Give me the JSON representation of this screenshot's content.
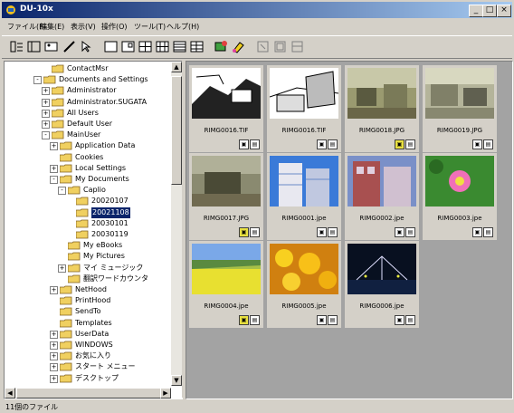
{
  "window": {
    "title": "DU-10x",
    "minimize": "_",
    "maximize": "□",
    "close": "×"
  },
  "menu": [
    "ファイル(F)",
    "編集(E)",
    "表示(V)",
    "操作(O)",
    "ツール(T)",
    "ヘルプ(H)"
  ],
  "tree": [
    {
      "label": "ContactMsr",
      "exp": "",
      "depth": 4
    },
    {
      "label": "Documents and Settings",
      "exp": "-",
      "depth": 3
    },
    {
      "label": "Administrator",
      "exp": "+",
      "depth": 4
    },
    {
      "label": "Administrator.SUGATA",
      "exp": "+",
      "depth": 4
    },
    {
      "label": "All Users",
      "exp": "+",
      "depth": 4
    },
    {
      "label": "Default User",
      "exp": "+",
      "depth": 4
    },
    {
      "label": "MainUser",
      "exp": "-",
      "depth": 4
    },
    {
      "label": "Application Data",
      "exp": "+",
      "depth": 5
    },
    {
      "label": "Cookies",
      "exp": "",
      "depth": 5
    },
    {
      "label": "Local Settings",
      "exp": "+",
      "depth": 5
    },
    {
      "label": "My Documents",
      "exp": "-",
      "depth": 5
    },
    {
      "label": "Caplio",
      "exp": "-",
      "depth": 6
    },
    {
      "label": "20020107",
      "exp": "",
      "depth": 7
    },
    {
      "label": "20021108",
      "exp": "",
      "depth": 7,
      "selected": true
    },
    {
      "label": "20030101",
      "exp": "",
      "depth": 7
    },
    {
      "label": "20030119",
      "exp": "",
      "depth": 7
    },
    {
      "label": "My eBooks",
      "exp": "",
      "depth": 6
    },
    {
      "label": "My Pictures",
      "exp": "",
      "depth": 6
    },
    {
      "label": "マイ ミュージック",
      "exp": "+",
      "depth": 6
    },
    {
      "label": "翻訳ワードカウンタ",
      "exp": "",
      "depth": 6
    },
    {
      "label": "NetHood",
      "exp": "+",
      "depth": 5
    },
    {
      "label": "PrintHood",
      "exp": "",
      "depth": 5
    },
    {
      "label": "SendTo",
      "exp": "",
      "depth": 5
    },
    {
      "label": "Templates",
      "exp": "",
      "depth": 5
    },
    {
      "label": "UserData",
      "exp": "+",
      "depth": 5
    },
    {
      "label": "WINDOWS",
      "exp": "+",
      "depth": 5
    },
    {
      "label": "お気に入り",
      "exp": "+",
      "depth": 5
    },
    {
      "label": "スタート メニュー",
      "exp": "+",
      "depth": 5
    },
    {
      "label": "デスクトップ",
      "exp": "+",
      "depth": 5
    }
  ],
  "thumbnails": [
    {
      "name": "RIMG0016.TIF",
      "scene": "sketch",
      "mark": ""
    },
    {
      "name": "RIMG0016.TIF",
      "scene": "sketch2",
      "mark": ""
    },
    {
      "name": "RIMG0018.JPG",
      "scene": "office",
      "mark": "y"
    },
    {
      "name": "RIMG0019.JPG",
      "scene": "office2",
      "mark": ""
    },
    {
      "name": "RIMG0017.JPG",
      "scene": "office3",
      "mark": "y"
    },
    {
      "name": "RIMG0001.jpe",
      "scene": "building",
      "mark": ""
    },
    {
      "name": "RIMG0002.jpe",
      "scene": "building2",
      "mark": ""
    },
    {
      "name": "RIMG0003.jpe",
      "scene": "flower",
      "mark": ""
    },
    {
      "name": "RIMG0004.jpe",
      "scene": "field",
      "mark": "y"
    },
    {
      "name": "RIMG0005.jpe",
      "scene": "yellow",
      "mark": ""
    },
    {
      "name": "RIMG0006.jpe",
      "scene": "night",
      "mark": ""
    }
  ],
  "status": "11個のファイル",
  "colors": {
    "titlebar_start": "#0a246a",
    "titlebar_end": "#a6caf0",
    "pane_bg": "#a3a3a3",
    "selection": "#0a246a"
  }
}
